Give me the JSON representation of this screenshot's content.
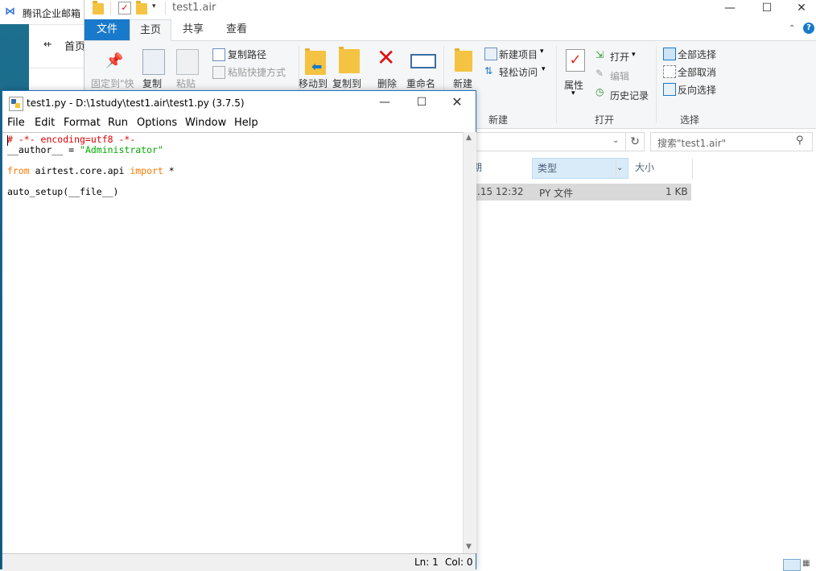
{
  "mail": {
    "app_name": "腾讯企业邮箱",
    "home_label": "首页"
  },
  "explorer": {
    "window_title": "test1.air",
    "tabs": [
      {
        "label": "文件"
      },
      {
        "label": "主页"
      },
      {
        "label": "共享"
      },
      {
        "label": "查看"
      }
    ],
    "ribbon": {
      "pin_label": "固定到\"快",
      "copy_label": "复制",
      "paste_label": "粘贴",
      "copy_path_label": "复制路径",
      "paste_shortcut_label": "粘贴快捷方式",
      "move_to_label": "移动到",
      "copy_to_label": "复制到",
      "delete_label": "删除",
      "rename_label": "重命名",
      "new_folder_label": "新建",
      "new_item_label": "新建项目",
      "easy_access_label": "轻松访问",
      "new_group": "新建",
      "properties_label": "属性",
      "open_label": "打开",
      "edit_label": "编辑",
      "history_label": "历史记录",
      "open_group": "打开",
      "select_all_label": "全部选择",
      "select_none_label": "全部取消",
      "invert_label": "反向选择",
      "select_group": "选择"
    },
    "search_placeholder": "搜索\"test1.air\"",
    "columns": {
      "date_partial": "期",
      "type": "类型",
      "size": "大小"
    },
    "rows": [
      {
        "date": ".15 12:32",
        "type": "PY 文件",
        "size": "1 KB"
      }
    ]
  },
  "idle": {
    "title": "test1.py - D:\\1study\\test1.air\\test1.py (3.7.5)",
    "menu": [
      "File",
      "Edit",
      "Format",
      "Run",
      "Options",
      "Window",
      "Help"
    ],
    "code": {
      "l1": "# -*- encoding=utf8 -*-",
      "l2a": "__author__ = ",
      "l2b": "\"Administrator\"",
      "l3a": "from",
      "l3b": " airtest.core.api ",
      "l3c": "import",
      "l3d": " *",
      "l4": "auto_setup(__file__)"
    },
    "status": {
      "ln": "Ln: 1",
      "col": "Col: 0"
    }
  },
  "colors": {
    "accent": "#1979ca",
    "selection": "#cce8ff"
  }
}
